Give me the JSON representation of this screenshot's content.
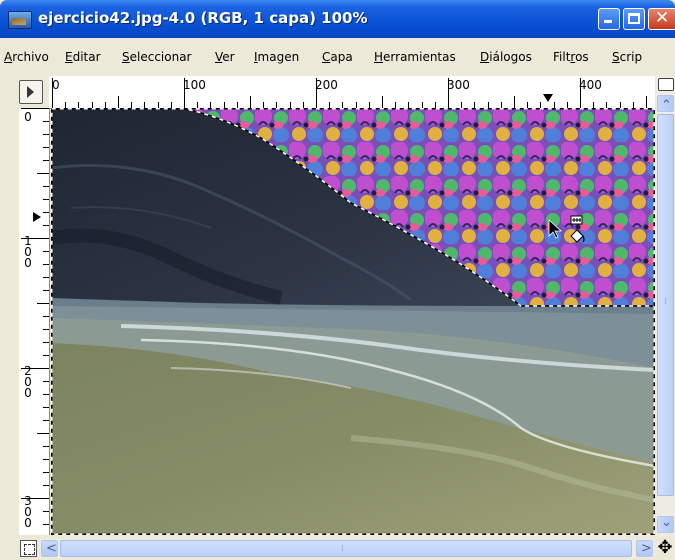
{
  "window": {
    "title": "ejercicio42.jpg-4.0 (RGB, 1 capa) 100%"
  },
  "menu": [
    {
      "label": "Archivo",
      "u": "A",
      "rest": "rchivo"
    },
    {
      "label": "Editar",
      "u": "E",
      "rest": "ditar"
    },
    {
      "label": "Seleccionar",
      "u": "S",
      "rest": "eleccionar"
    },
    {
      "label": "Ver",
      "u": "V",
      "rest": "er"
    },
    {
      "label": "Imagen",
      "u": "I",
      "rest": "magen"
    },
    {
      "label": "Capa",
      "u": "C",
      "rest": "apa"
    },
    {
      "label": "Herramientas",
      "u": "H",
      "rest": "erramientas"
    },
    {
      "label": "Diálogos",
      "u": "D",
      "rest": "iálogos"
    },
    {
      "label": "Filtros",
      "pre": "Filt",
      "u": "r",
      "rest": "os"
    },
    {
      "label": "Script-Fu",
      "u": "S",
      "rest": "crip"
    }
  ],
  "hruler": {
    "labels": [
      "0",
      "100",
      "200",
      "300",
      "400"
    ]
  },
  "vruler": {
    "labels": [
      "0",
      "100",
      "200",
      "300"
    ]
  },
  "icons": {
    "title": "gimp-image-icon",
    "minimize": "minimize-icon",
    "maximize": "maximize-icon",
    "close": "close-icon",
    "ruler_menu": "menu-arrow-icon",
    "nav": "navigation-icon",
    "move": "move-cross-icon",
    "cursor": "bucket-fill-cursor-icon"
  },
  "glyphs": {
    "close": "✕",
    "up": "⌃",
    "down": "⌄",
    "left": "<",
    "right": ">",
    "move": "✥",
    "grip": "⁞"
  },
  "colors": {
    "titlebar": "#0a54d8",
    "close_button": "#c8391e",
    "scroll": "#bcd0f6",
    "menubar": "#ece9d8"
  }
}
